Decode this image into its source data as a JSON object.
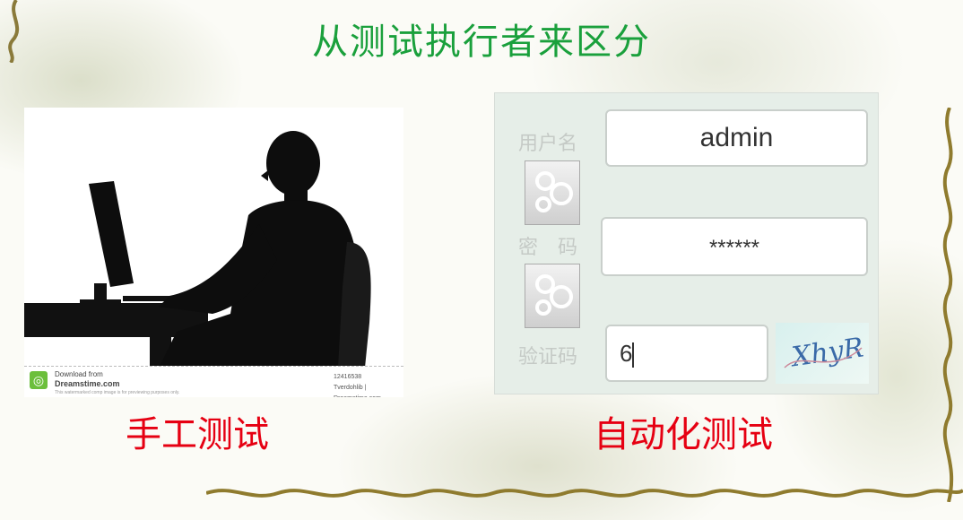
{
  "slide": {
    "title": "从测试执行者来区分"
  },
  "left": {
    "caption": "手工测试",
    "watermark": {
      "download_from": "Download from",
      "site": "Dreamstime.com",
      "fine_print": "This watermarked comp image is for previewing purposes only.",
      "id": "12416538",
      "credit": "Tverdohlib | Dreamstime.com"
    }
  },
  "right": {
    "caption": "自动化测试",
    "login": {
      "username_label": "用户名",
      "username_value": "admin",
      "password_label": "密　码",
      "password_value": "******",
      "captcha_label": "验证码",
      "captcha_value": "6",
      "captcha_image_text": "XhyR"
    }
  },
  "colors": {
    "title": "#1aa03c",
    "caption": "#e60012"
  }
}
